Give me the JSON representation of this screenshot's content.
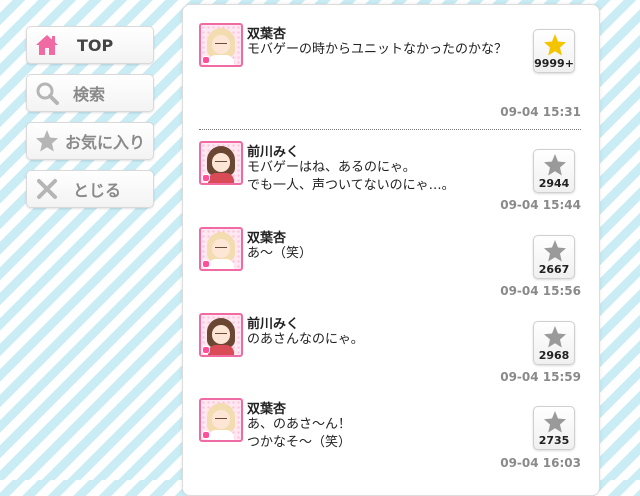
{
  "sidebar": {
    "items": [
      {
        "label": "TOP",
        "icon": "home-icon",
        "active": true
      },
      {
        "label": "検索",
        "icon": "search-icon",
        "active": false
      },
      {
        "label": "お気に入り",
        "icon": "star-icon",
        "active": false
      },
      {
        "label": "とじる",
        "icon": "close-icon",
        "active": false
      }
    ]
  },
  "messages": [
    {
      "name": "双葉杏",
      "lines": [
        "モバゲーの時からユニットなかったのかな？"
      ],
      "likes": "9999+",
      "liked": true,
      "time": "09-04 15:31"
    },
    {
      "name": "前川みく",
      "lines": [
        "モバゲーはね、あるのにゃ。",
        "でも一人、声ついてないのにゃ…。"
      ],
      "likes": "2944",
      "liked": false,
      "time": "09-04 15:44"
    },
    {
      "name": "双葉杏",
      "lines": [
        "あ～（笑）"
      ],
      "likes": "2667",
      "liked": false,
      "time": "09-04 15:56"
    },
    {
      "name": "前川みく",
      "lines": [
        "のあさんなのにゃ。"
      ],
      "likes": "2968",
      "liked": false,
      "time": "09-04 15:59"
    },
    {
      "name": "双葉杏",
      "lines": [
        "あ、のあさ～ん！",
        "つかなそ～（笑）"
      ],
      "likes": "2735",
      "liked": false,
      "time": "09-04 16:03"
    }
  ],
  "colors": {
    "accent_pink": "#f06aa3",
    "star_gold": "#f5c400",
    "star_gray": "#9a9a9a",
    "stripe": "#c9ecf5"
  }
}
